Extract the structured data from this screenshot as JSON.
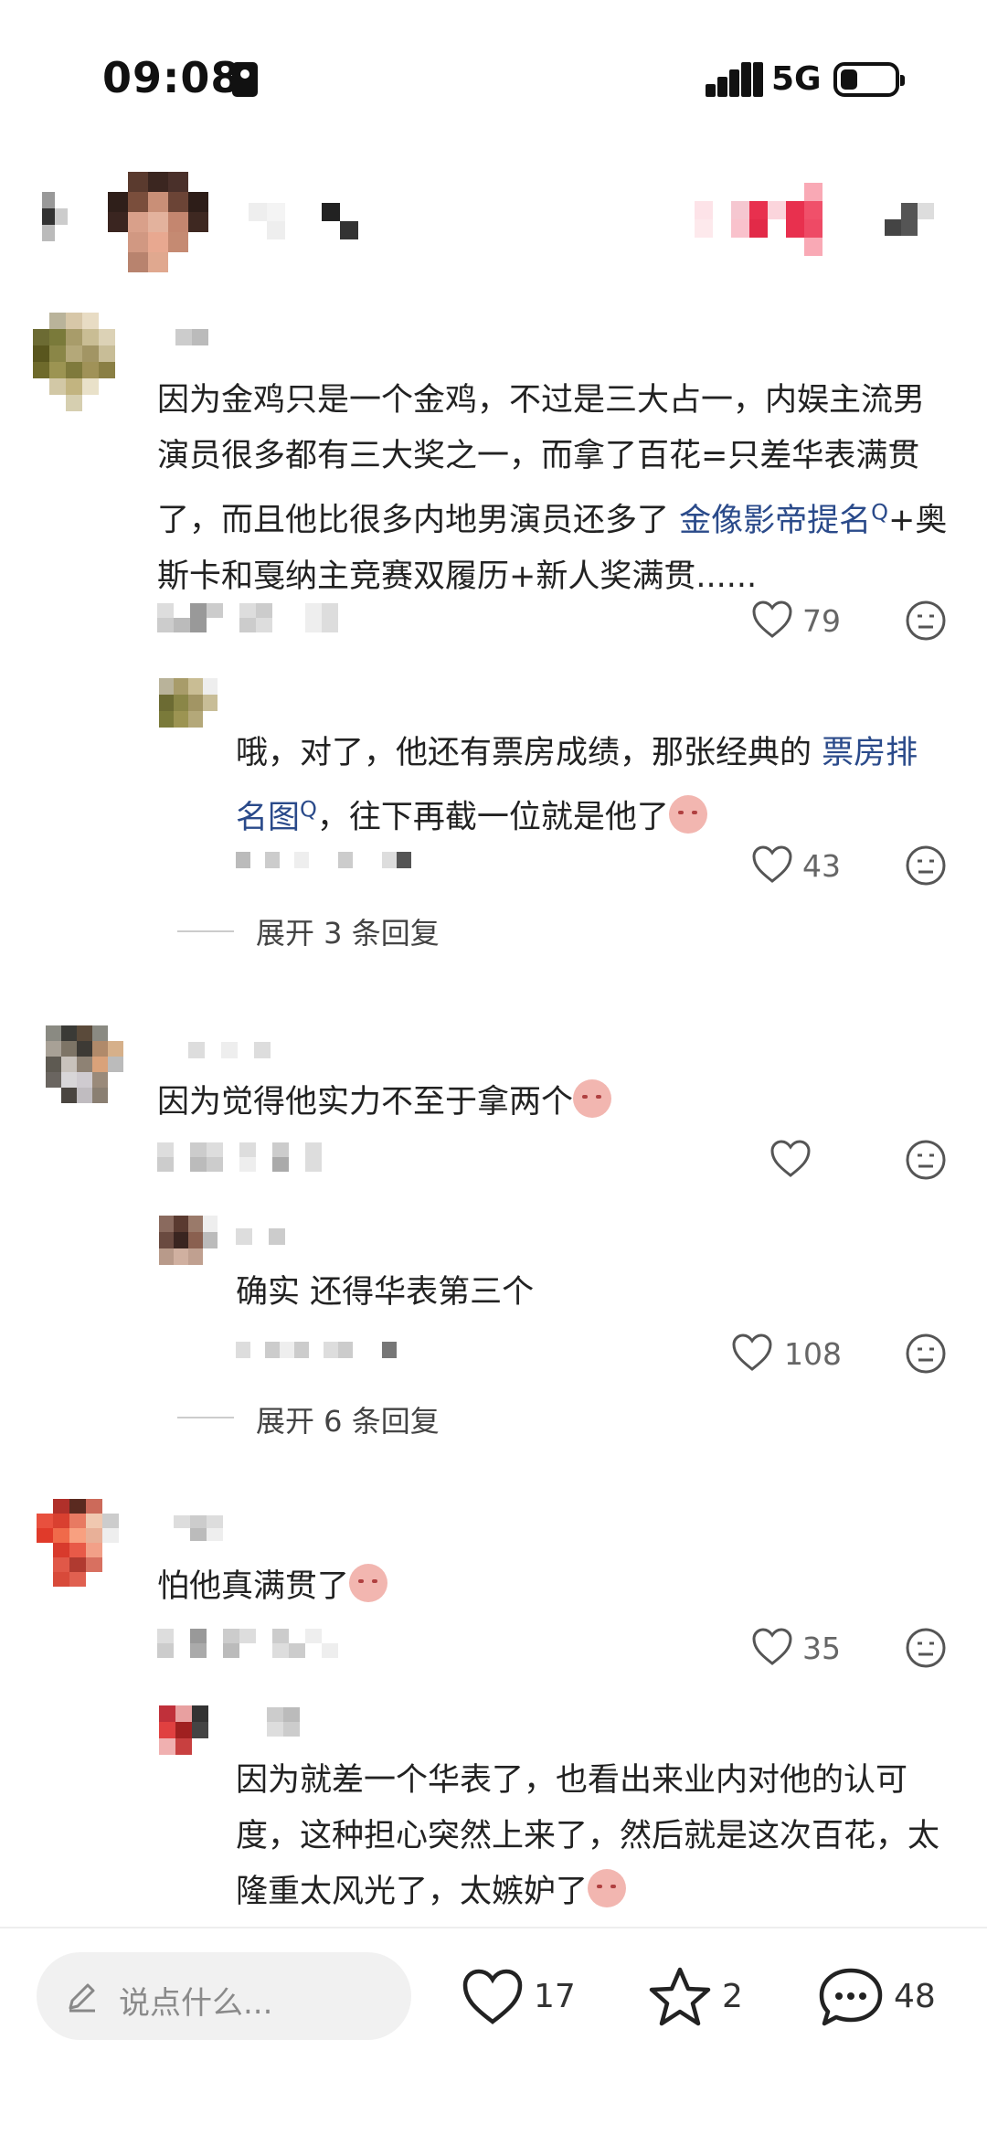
{
  "status_bar": {
    "time": "09:08",
    "network": "5G"
  },
  "comments": [
    {
      "text_parts": [
        {
          "t": "因为金鸡只是一个金鸡，不过是三大占一，内娱主流男演员很多都有三大奖之一，而拿了百花=只差华表满贯了，而且他比很多内地男演员还多了 "
        },
        {
          "t": "金像影帝提名",
          "link": true
        },
        {
          "t": "+奥斯卡和戛纳主竞赛双履历+新人奖满贯......"
        }
      ],
      "likes": "79",
      "reply": {
        "text_parts": [
          {
            "t": "哦，对了，他还有票房成绩，那张经典的 "
          },
          {
            "t": "票房排名图",
            "link": true
          },
          {
            "t": "，往下再截一位就是他了"
          }
        ],
        "likes": "43"
      },
      "expand_label": "展开 3 条回复"
    },
    {
      "text": "因为觉得他实力不至于拿两个",
      "likes": "",
      "reply": {
        "text": "确实 还得华表第三个",
        "likes": "108"
      },
      "expand_label": "展开 6 条回复"
    },
    {
      "text": "怕他真满贯了",
      "likes": "35",
      "reply": {
        "text": "因为就差一个华表了，也看出来业内对他的认可度，这种担心突然上来了，然后就是这次百花，太隆重太风光了，太嫉妒了"
      }
    }
  ],
  "bottom_bar": {
    "placeholder": "说点什么...",
    "like_count": "17",
    "star_count": "2",
    "comment_count": "48"
  },
  "icons": {
    "like": "heart-outline-icon",
    "dislike": "dislike-face-icon",
    "star": "star-outline-icon",
    "comment": "comment-bubble-icon",
    "edit": "pencil-icon"
  }
}
